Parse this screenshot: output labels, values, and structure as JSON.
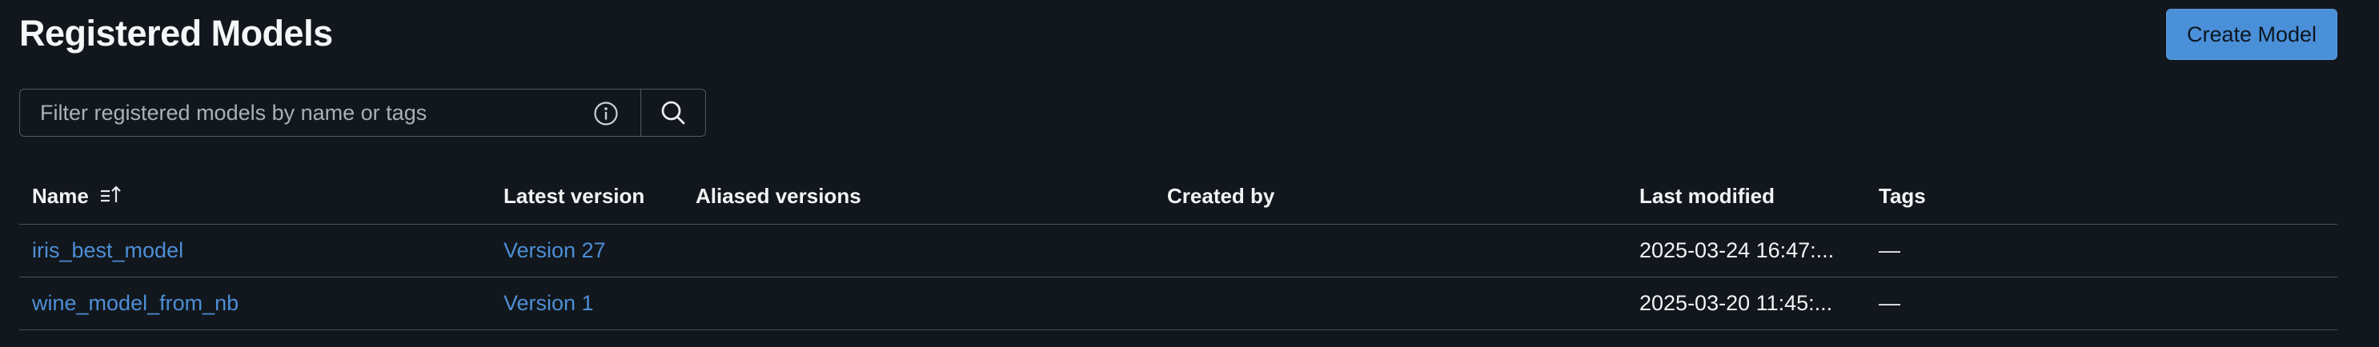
{
  "header": {
    "title": "Registered Models",
    "create_button_label": "Create Model"
  },
  "search": {
    "placeholder": "Filter registered models by name or tags",
    "value": "",
    "info_icon": "info-icon",
    "search_icon": "search-icon"
  },
  "table": {
    "columns": [
      {
        "label": "Name",
        "sort_icon": "sort-ascending-icon"
      },
      {
        "label": "Latest version"
      },
      {
        "label": "Aliased versions"
      },
      {
        "label": "Created by"
      },
      {
        "label": "Last modified"
      },
      {
        "label": "Tags"
      }
    ],
    "rows": [
      {
        "name": "iris_best_model",
        "latest_version": "Version 27",
        "aliased_versions": "",
        "created_by": "",
        "last_modified": "2025-03-24 16:47:...",
        "tags": "—"
      },
      {
        "name": "wine_model_from_nb",
        "latest_version": "Version 1",
        "aliased_versions": "",
        "created_by": "",
        "last_modified": "2025-03-20 11:45:...",
        "tags": "—"
      }
    ]
  },
  "colors": {
    "background": "#11171c",
    "accent": "#4a90d9",
    "link": "#4e8ed6",
    "border": "#4a535b"
  }
}
